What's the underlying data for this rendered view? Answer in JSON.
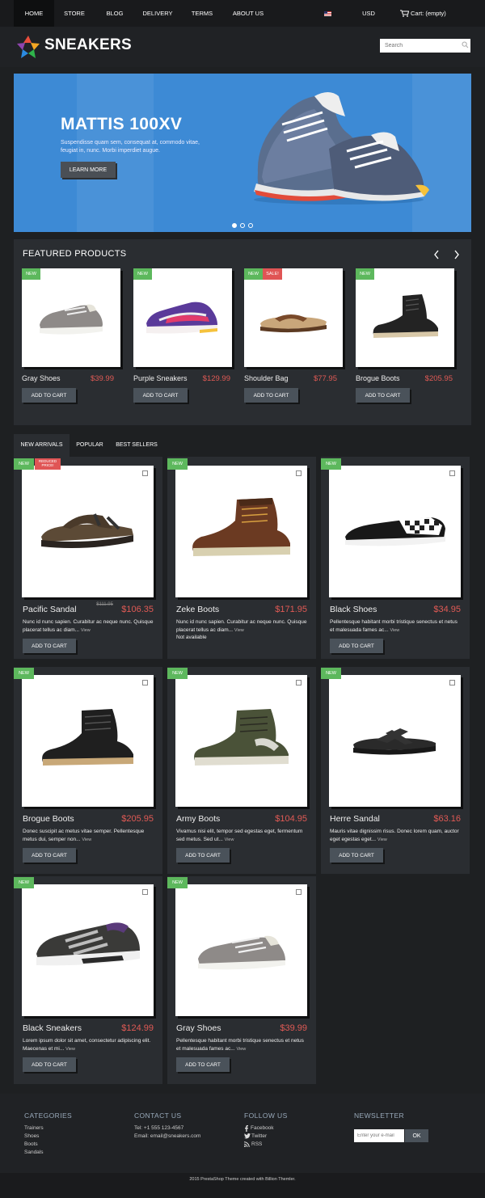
{
  "nav": {
    "items": [
      "HOME",
      "STORE",
      "BLOG",
      "DELIVERY",
      "TERMS",
      "ABOUT US"
    ],
    "currency": "USD",
    "cart": "Cart: (empty)"
  },
  "header": {
    "logo_text": "SNEAKERS",
    "search_placeholder": "Search"
  },
  "hero": {
    "title": "MATTIS 100XV",
    "subtitle": "Suspendisse quam sem, consequat at, commodo vitae, feugiat in, nunc. Morbi imperdiet augue.",
    "button": "LEARN MORE",
    "slides": 3,
    "active_slide": 1
  },
  "featured": {
    "title": "FEATURED PRODUCTS",
    "products": [
      {
        "name": "Gray Shoes",
        "price": "$39.99",
        "badges": [
          "NEW"
        ]
      },
      {
        "name": "Purple Sneakers",
        "price": "$129.99",
        "badges": [
          "NEW"
        ]
      },
      {
        "name": "Shoulder Bag",
        "price": "$77.95",
        "badges": [
          "NEW",
          "SALE!"
        ]
      },
      {
        "name": "Brogue Boots",
        "price": "$205.95",
        "badges": [
          "NEW"
        ]
      }
    ],
    "add_to_cart": "ADD TO CART"
  },
  "tabs": [
    "NEW ARRIVALS",
    "POPULAR",
    "BEST SELLERS"
  ],
  "grid": {
    "add_to_cart": "ADD TO CART",
    "view_label": "View",
    "products": [
      {
        "name": "Pacific Sandal",
        "price": "$106.35",
        "old_price": "$111.95",
        "reduced": "REDUCED PRICE!",
        "desc": "Nunc id nunc sapien. Curabitur ac neque nunc. Quisque placerat tellus ac diam...",
        "badge": "NEW"
      },
      {
        "name": "Zeke Boots",
        "price": "$171.95",
        "desc": "Nunc id nunc sapien. Curabitur ac neque nunc. Quisque placerat tellus ac diam...",
        "availability": "Not available",
        "badge": "NEW"
      },
      {
        "name": "Black Shoes",
        "price": "$34.95",
        "desc": "Pellentesque habitant morbi tristique senectus et netus et malesuada fames ac...",
        "badge": "NEW"
      },
      {
        "name": "Brogue Boots",
        "price": "$205.95",
        "desc": "Donec suscipit ac metus vitae semper. Pellentesque metus dui, semper non...",
        "badge": "NEW"
      },
      {
        "name": "Army Boots",
        "price": "$104.95",
        "desc": "Vivamus nisi elit, tempor sed egestas eget, fermentum sed metus. Sed ut...",
        "badge": "NEW"
      },
      {
        "name": "Herre Sandal",
        "price": "$63.16",
        "desc": "Mauris vitae dignissim risus. Donec lorem quam, auctor eget egestas eget...",
        "badge": "NEW"
      },
      {
        "name": "Black Sneakers",
        "price": "$124.99",
        "desc": "Lorem ipsum dolor sit amet, consectetur adipiscing elit. Maecenas et mi...",
        "badge": "NEW"
      },
      {
        "name": "Gray Shoes",
        "price": "$39.99",
        "desc": "Pellentesque habitant morbi tristique senectus et netus et malesuada fames ac...",
        "badge": "NEW"
      }
    ]
  },
  "footer": {
    "categories": {
      "title": "CATEGORIES",
      "items": [
        "Trainers",
        "Shoes",
        "Boots",
        "Sandals"
      ]
    },
    "contact": {
      "title": "CONTACT US",
      "tel": "Tel: +1 555 123-4567",
      "email": "Email: email@sneakers.com"
    },
    "follow": {
      "title": "FOLLOW US",
      "items": [
        "Facebook",
        "Twitter",
        "RSS"
      ]
    },
    "newsletter": {
      "title": "NEWSLETTER",
      "placeholder": "Enter your e-mail",
      "button": "OK"
    },
    "copyright": "2015 PrestaShop Theme created with Billion Themler."
  },
  "colors": {
    "accent_price": "#e05a55",
    "badge_new": "#5db85d",
    "badge_sale": "#e05555",
    "hero_bg": "#3d8ad5"
  }
}
